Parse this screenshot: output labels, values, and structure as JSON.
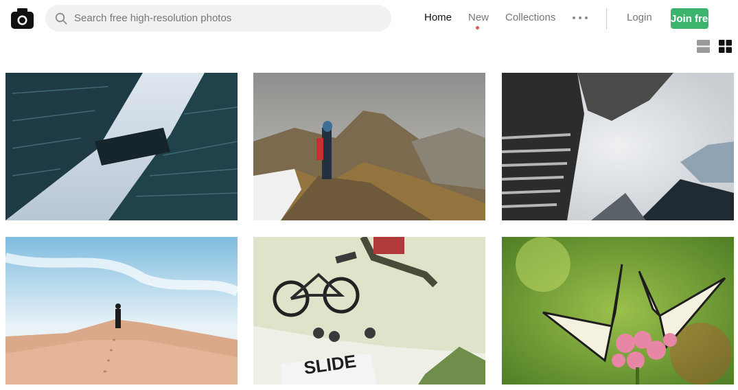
{
  "header": {
    "search_placeholder": "Search free high-resolution photos",
    "nav": {
      "home": "Home",
      "new": "New",
      "collections": "Collections",
      "login": "Login",
      "join": "Join free"
    }
  },
  "colors": {
    "accent_green": "#3cb46e",
    "new_indicator": "#e25c5c",
    "search_bg": "#f1f1f1"
  },
  "icons": [
    "camera-logo-icon",
    "search-icon",
    "more-dots-icon",
    "list-view-icon",
    "grid-view-icon"
  ],
  "view_mode": "grid",
  "photos": [
    {
      "subject": "skyscrapers-from-below"
    },
    {
      "subject": "hiker-on-mountain-ridge"
    },
    {
      "subject": "towers-in-fog"
    },
    {
      "subject": "person-walking-in-desert"
    },
    {
      "subject": "bmx-rider-jump"
    },
    {
      "subject": "butterflies-on-flowers"
    }
  ]
}
